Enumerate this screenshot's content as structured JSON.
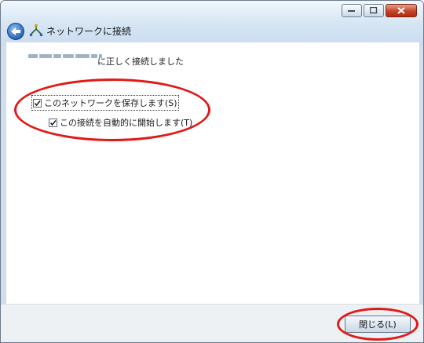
{
  "window": {
    "title": "ネットワークに接続",
    "controls": [
      "minimize-icon",
      "maximize-icon",
      "close-icon"
    ],
    "accent_color": "#cfdfee"
  },
  "main": {
    "message": "に正しく接続しました",
    "network_name": "(redacted)",
    "checkboxes": [
      {
        "label": "このネットワークを保存します(S)",
        "checked": true
      },
      {
        "label": "この接続を自動的に開始します(T)",
        "checked": true
      }
    ]
  },
  "footer": {
    "close_label": "閉じる(L)"
  },
  "annotation_color": "#e11919"
}
